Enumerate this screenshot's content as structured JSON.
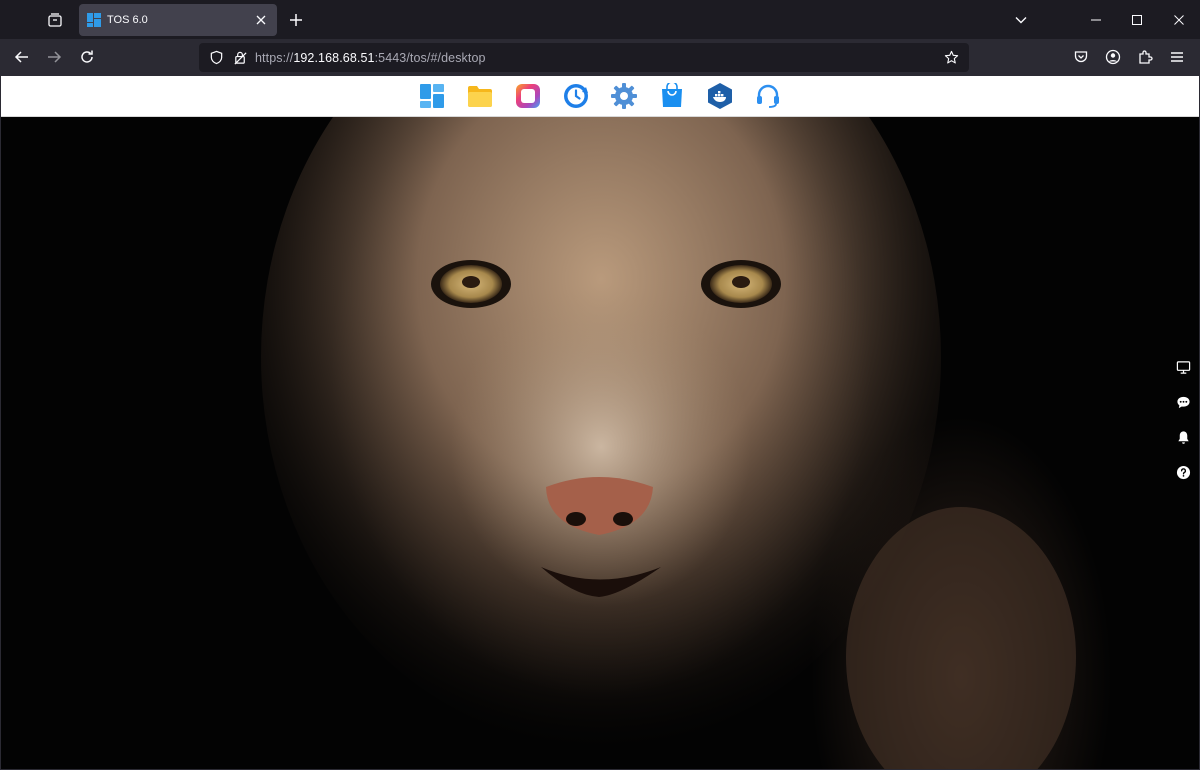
{
  "browser": {
    "tab": {
      "title": "TOS 6.0"
    },
    "url": {
      "scheme": "https://",
      "host": "192.168.68.51",
      "rest": ":5443/tos/#/desktop"
    }
  },
  "dock": {
    "apps": [
      {
        "icon": "app-launcher-icon",
        "color": "#2f9be9"
      },
      {
        "icon": "file-manager-icon",
        "color": "#f6b71c"
      },
      {
        "icon": "photos-icon",
        "color": "#e6457a"
      },
      {
        "icon": "backup-icon",
        "color": "#1e7fe8"
      },
      {
        "icon": "settings-icon",
        "color": "#4f8fd6"
      },
      {
        "icon": "app-center-icon",
        "color": "#1a8ff0"
      },
      {
        "icon": "docker-icon",
        "color": "#1e5fa8"
      },
      {
        "icon": "support-icon",
        "color": "#2c8ff0"
      }
    ]
  },
  "side_tools": [
    {
      "icon": "monitor-icon"
    },
    {
      "icon": "chat-icon"
    },
    {
      "icon": "bell-icon"
    },
    {
      "icon": "help-icon"
    }
  ],
  "colors": {
    "chrome_dark": "#1c1b22",
    "toolbar": "#2b2a33",
    "tab_active": "#42414d"
  }
}
